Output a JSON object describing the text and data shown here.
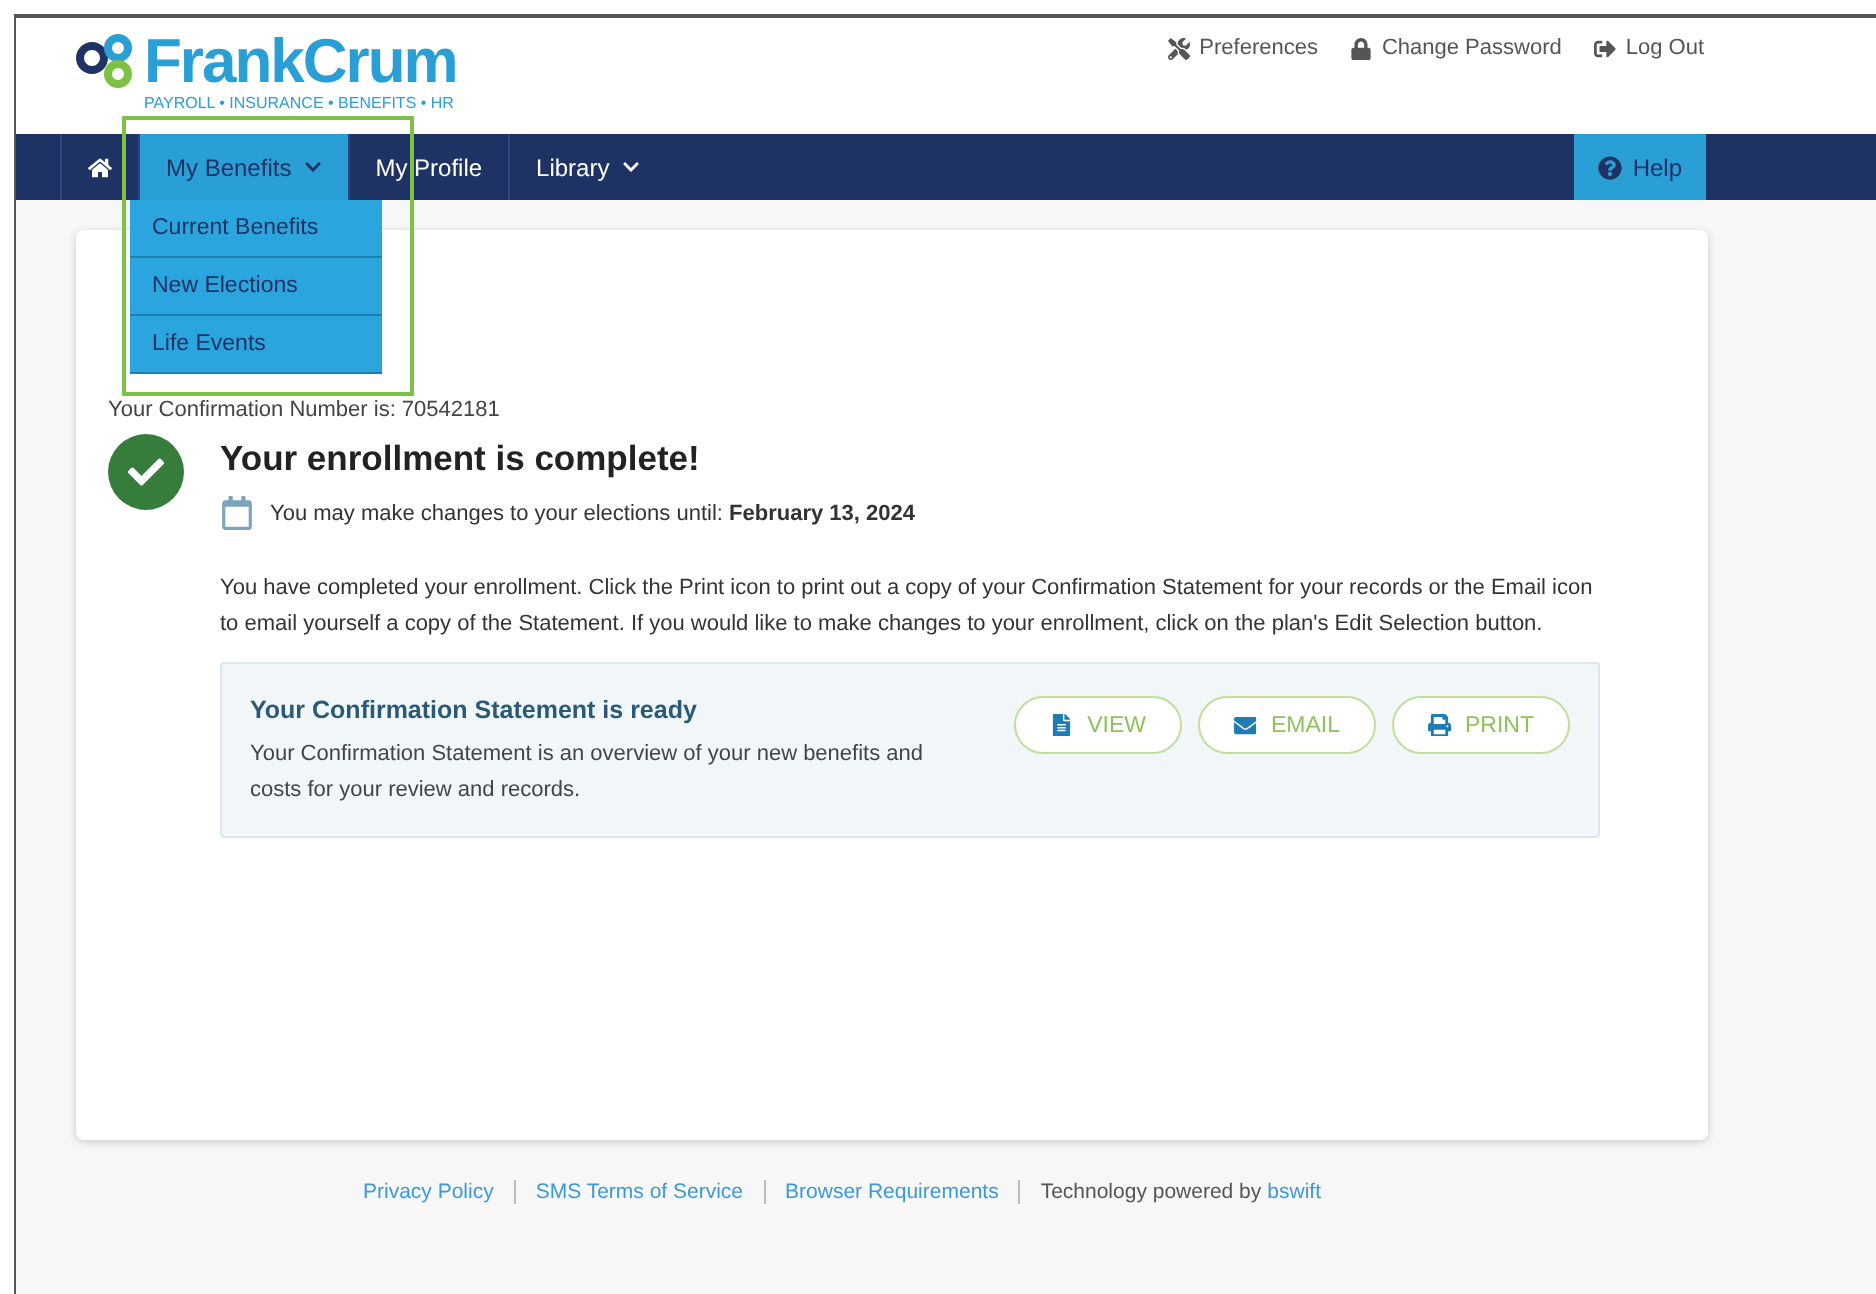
{
  "logo": {
    "name": "FrankCrum",
    "tagline": "PAYROLL • INSURANCE • BENEFITS • HR"
  },
  "top_links": [
    {
      "kind": "preferences",
      "label": "Preferences"
    },
    {
      "kind": "password",
      "label": "Change Password"
    },
    {
      "kind": "logout",
      "label": "Log Out"
    }
  ],
  "nav": {
    "items": [
      {
        "kind": "home",
        "selected": false,
        "has_menu": false
      },
      {
        "kind": "text",
        "label": "My Benefits",
        "selected": true,
        "has_menu": true
      },
      {
        "kind": "text",
        "label": "My Profile",
        "selected": false,
        "has_menu": false
      },
      {
        "kind": "text",
        "label": "Library",
        "selected": false,
        "has_menu": true
      }
    ],
    "dropdown": [
      "Current Benefits",
      "New Elections",
      "Life Events"
    ],
    "help": "Help"
  },
  "confirmation_number": "Your Confirmation Number is: 70542181",
  "status": {
    "title": "Your enrollment is complete!",
    "deadline_label": "You may make changes to your elections until:",
    "deadline": "February 13, 2024",
    "body": "You have completed your enrollment. Click the Print icon to print out a copy of your Confirmation Statement for your records or the Email icon to email yourself a copy of the Statement. If you would like to make changes to your enrollment, click on the plan's Edit Selection button."
  },
  "statement": {
    "title": "Your Confirmation Statement is ready",
    "text": "Your Confirmation Statement is an overview of your new benefits and costs for your review and records.",
    "buttons": [
      {
        "kind": "view",
        "label": "VIEW"
      },
      {
        "kind": "email",
        "label": "EMAIL"
      },
      {
        "kind": "print",
        "label": "PRINT"
      }
    ]
  },
  "footer": {
    "links": [
      "Privacy Policy",
      "SMS Terms of Service",
      "Browser Requirements"
    ],
    "powered_text": "Technology powered by",
    "powered_link": "bswift"
  }
}
